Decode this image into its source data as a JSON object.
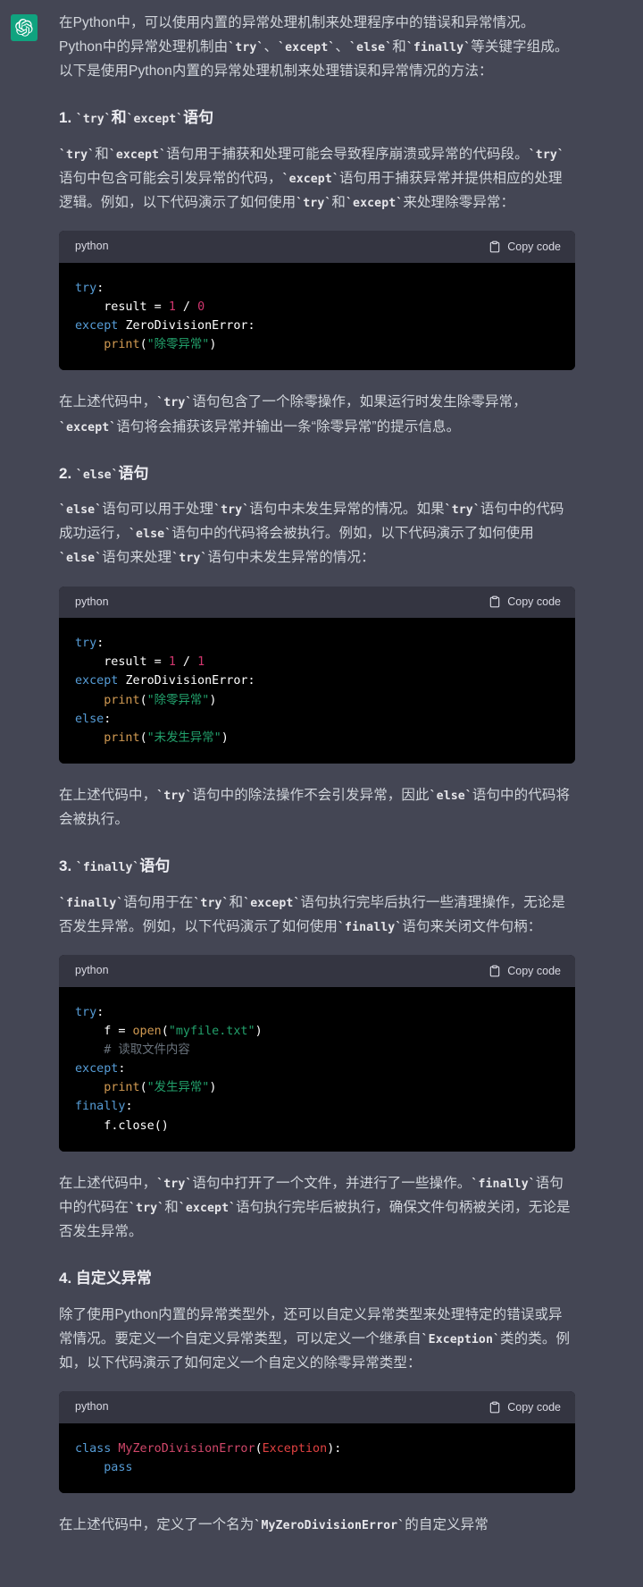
{
  "avatar": {
    "name": "openai-logo",
    "bg": "#10a37f"
  },
  "code_ui": {
    "lang_label": "python",
    "copy_label": "Copy code",
    "copy_icon": "clipboard-icon"
  },
  "colors": {
    "page_bg": "#444654",
    "code_bg": "#000000",
    "code_head_bg": "#343541",
    "text": "#d1d5db",
    "accent_green": "#10a37f",
    "kw_blue": "#569cd6",
    "num_pink": "#d1366e",
    "str_green": "#22a06b",
    "fn_orange": "#d19a52",
    "comment_gray": "#6a737d",
    "class_red": "#d1476a",
    "exception_red": "#e04141"
  },
  "message": {
    "intro": "在Python中，可以使用内置的异常处理机制来处理程序中的错误和异常情况。Python中的异常处理机制由`try`、`except`、`else`和`finally`等关键字组成。以下是使用Python内置的异常处理机制来处理错误和异常情况的方法：",
    "sections": [
      {
        "heading": "1. `try`和`except`语句",
        "intro": "`try`和`except`语句用于捕获和处理可能会导致程序崩溃或异常的代码段。`try`语句中包含可能会引发异常的代码，`except`语句用于捕获异常并提供相应的处理逻辑。例如，以下代码演示了如何使用`try`和`except`来处理除零异常：",
        "code": "try:\n    result = 1 / 0\nexcept ZeroDivisionError:\n    print(\"除零异常\")",
        "outro": "在上述代码中，`try`语句包含了一个除零操作，如果运行时发生除零异常，`except`语句将会捕获该异常并输出一条“除零异常”的提示信息。"
      },
      {
        "heading": "2. `else`语句",
        "intro": "`else`语句可以用于处理`try`语句中未发生异常的情况。如果`try`语句中的代码成功运行，`else`语句中的代码将会被执行。例如，以下代码演示了如何使用`else`语句来处理`try`语句中未发生异常的情况：",
        "code": "try:\n    result = 1 / 1\nexcept ZeroDivisionError:\n    print(\"除零异常\")\nelse:\n    print(\"未发生异常\")",
        "outro": "在上述代码中，`try`语句中的除法操作不会引发异常，因此`else`语句中的代码将会被执行。"
      },
      {
        "heading": "3. `finally`语句",
        "intro": "`finally`语句用于在`try`和`except`语句执行完毕后执行一些清理操作，无论是否发生异常。例如，以下代码演示了如何使用`finally`语句来关闭文件句柄：",
        "code": "try:\n    f = open(\"myfile.txt\")\n    # 读取文件内容\nexcept:\n    print(\"发生异常\")\nfinally:\n    f.close()",
        "outro": "在上述代码中，`try`语句中打开了一个文件，并进行了一些操作。`finally`语句中的代码在`try`和`except`语句执行完毕后被执行，确保文件句柄被关闭，无论是否发生异常。"
      },
      {
        "heading": "4. 自定义异常",
        "intro": "除了使用Python内置的异常类型外，还可以自定义异常类型来处理特定的错误或异常情况。要定义一个自定义异常类型，可以定义一个继承自`Exception`类的类。例如，以下代码演示了如何定义一个自定义的除零异常类型：",
        "code": "class MyZeroDivisionError(Exception):\n    pass",
        "outro": "在上述代码中，定义了一个名为`MyZeroDivisionError`的自定义异常"
      }
    ]
  }
}
